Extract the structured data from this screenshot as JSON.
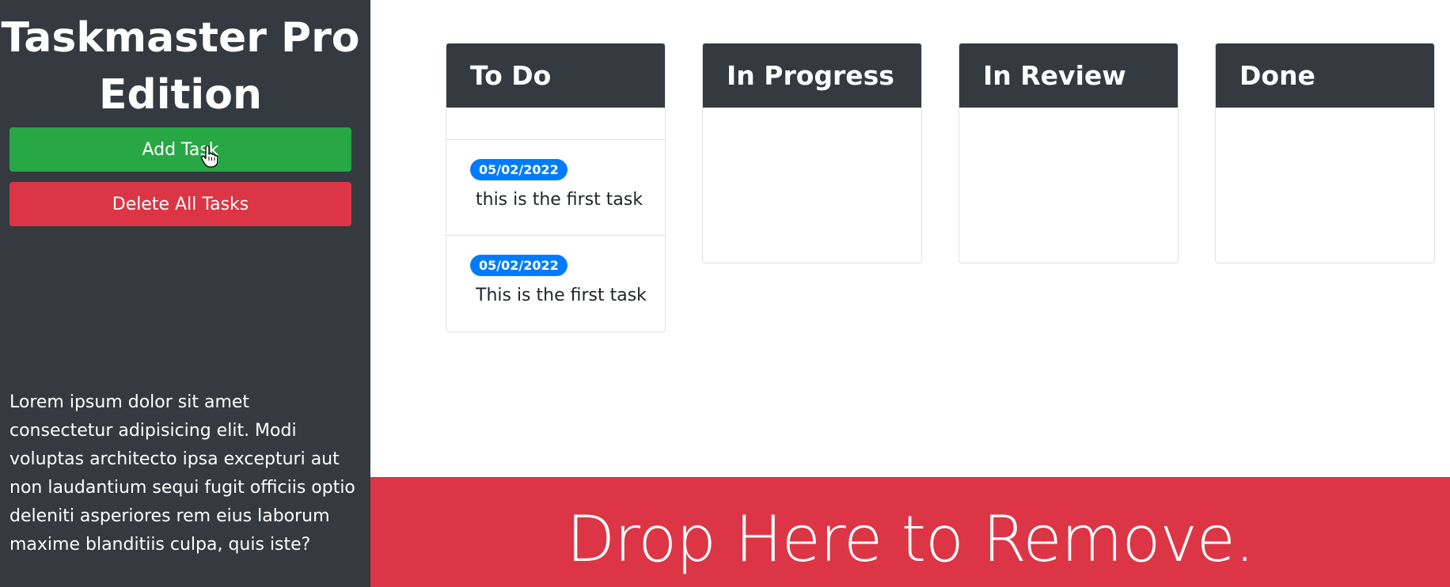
{
  "sidebar": {
    "title_line1": "Taskmaster Pro",
    "title_line2": "Edition",
    "add_task_label": "Add Task",
    "delete_all_label": "Delete All Tasks",
    "description": "Lorem ipsum dolor sit amet consectetur adipisicing elit. Modi voluptas architecto ipsa excepturi aut non laudantium sequi fugit officiis optio deleniti asperiores rem eius laborum maxime blanditiis culpa, quis iste?"
  },
  "columns": {
    "todo": {
      "title": "To Do",
      "tasks": [
        {
          "date": "05/02/2022",
          "text": "this is the first task"
        },
        {
          "date": "05/02/2022",
          "text": "This is the first task"
        }
      ]
    },
    "in_progress": {
      "title": "In Progress"
    },
    "in_review": {
      "title": "In Review"
    },
    "done": {
      "title": "Done"
    }
  },
  "drop_zone": {
    "label": "Drop Here to Remove."
  },
  "colors": {
    "sidebar_bg": "#343a40",
    "add_button": "#28a745",
    "delete_button": "#dc3545",
    "badge": "#007bff",
    "drop_zone": "#dc3545"
  },
  "icons": {
    "cursor": "hand-pointer-icon"
  }
}
